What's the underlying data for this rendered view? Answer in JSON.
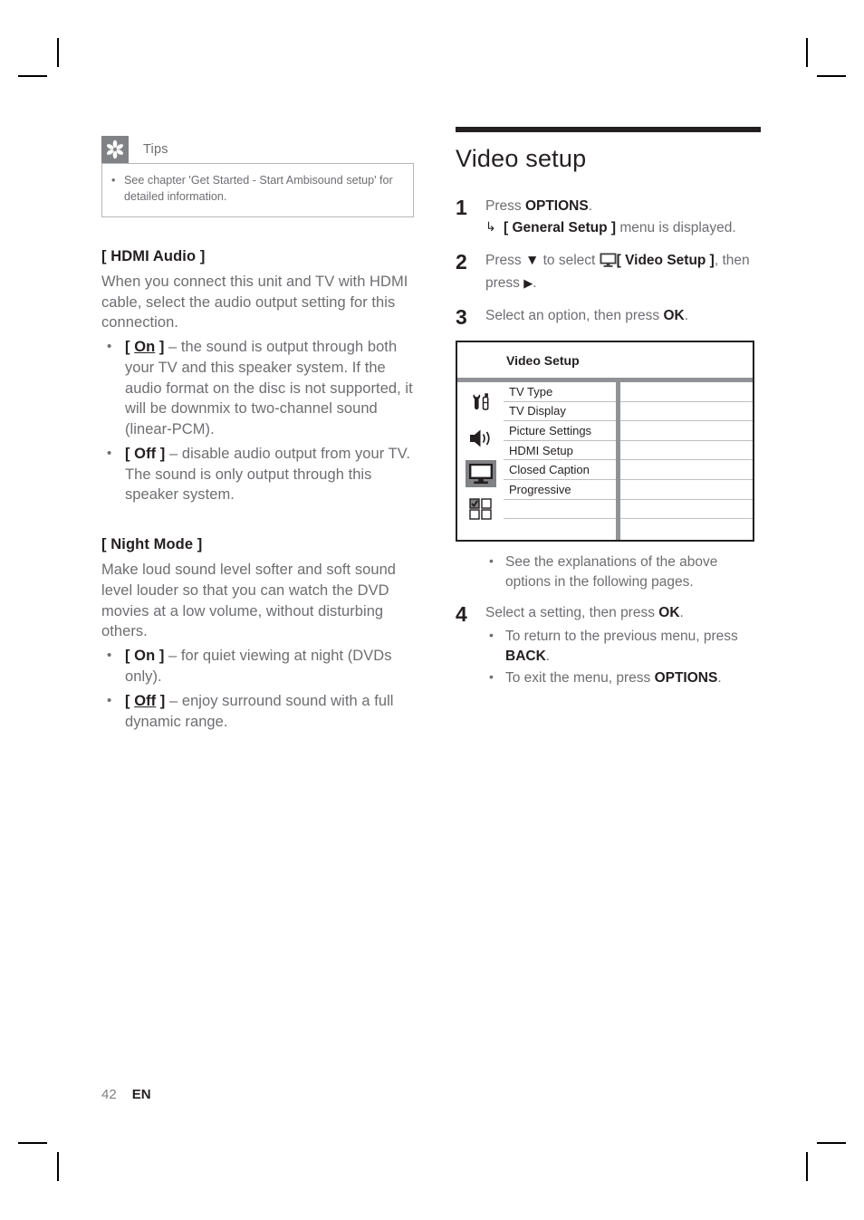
{
  "page": {
    "number": "42",
    "language": "EN"
  },
  "tips": {
    "icon": "asterisk-icon",
    "title": "Tips",
    "items": [
      "See chapter 'Get Started - Start Ambisound setup' for detailed information."
    ]
  },
  "left_column": {
    "sections": [
      {
        "heading": "[ HDMI Audio ]",
        "paragraph": "When you connect this unit and TV with HDMI cable, select the audio output setting for this connection.",
        "bullets": [
          {
            "option": "[ On ]",
            "option_underline": "On",
            "text": " – the sound is output through both your TV and this speaker system. If the audio format on the disc is not supported, it will be downmix to two-channel sound (linear-PCM)."
          },
          {
            "option": "[ Off ]",
            "option_underline": "",
            "text": " – disable audio output from your TV. The sound is only output through this speaker system."
          }
        ]
      },
      {
        "heading": "[ Night Mode ]",
        "paragraph": "Make loud sound level softer and soft sound level louder so that you can watch the DVD movies at a low volume, without disturbing others.",
        "bullets": [
          {
            "option": "[ On ]",
            "option_underline": "",
            "text": " – for quiet viewing at night (DVDs only)."
          },
          {
            "option": "[ Off ]",
            "option_underline": "Off",
            "text": " – enjoy surround sound with a full dynamic range."
          }
        ]
      }
    ]
  },
  "right_column": {
    "title": "Video setup",
    "steps": [
      {
        "number": "1",
        "text_before": "Press ",
        "keyword": "OPTIONS",
        "text_after": ".",
        "result_arrow": "↳",
        "result_bold": "[ General Setup ]",
        "result_text": " menu is displayed."
      },
      {
        "number": "2",
        "line1_a": "Press ",
        "line1_down": "▼",
        "line1_b": " to select ",
        "line1_icon": "monitor-icon",
        "line1_bold": "[ Video Setup ]",
        "line1_c": ", then press ",
        "line1_right": "▶",
        "line1_d": "."
      },
      {
        "number": "3",
        "text_before": "Select an option, then press ",
        "keyword": "OK",
        "text_after": "."
      }
    ],
    "after_table_bullets": [
      "See the explanations of the above options in the following pages."
    ],
    "step4": {
      "number": "4",
      "text_before": "Select a setting, then press ",
      "keyword": "OK",
      "text_after": ".",
      "bullets": [
        {
          "text_before": "To return to the previous menu, press ",
          "keyword": "BACK",
          "text_after": "."
        },
        {
          "text_before": "To exit the menu, press ",
          "keyword": "OPTIONS",
          "text_after": "."
        }
      ]
    },
    "menu": {
      "title": "Video Setup",
      "icons": [
        {
          "name": "tools-icon",
          "selected": false
        },
        {
          "name": "speaker-icon",
          "selected": false
        },
        {
          "name": "monitor-icon",
          "selected": true
        },
        {
          "name": "checkbox-grid-icon",
          "selected": false
        }
      ],
      "rows": [
        "TV Type",
        "TV Display",
        "Picture Settings",
        "HDMI Setup",
        "Closed Caption",
        "Progressive",
        "",
        ""
      ],
      "values": [
        "",
        "",
        "",
        "",
        "",
        "",
        "",
        ""
      ]
    }
  },
  "colors": {
    "body_text": "#6d6e71",
    "heading": "#231f20",
    "accent_gray": "#808285",
    "rule_gray": "#bcbec0"
  }
}
